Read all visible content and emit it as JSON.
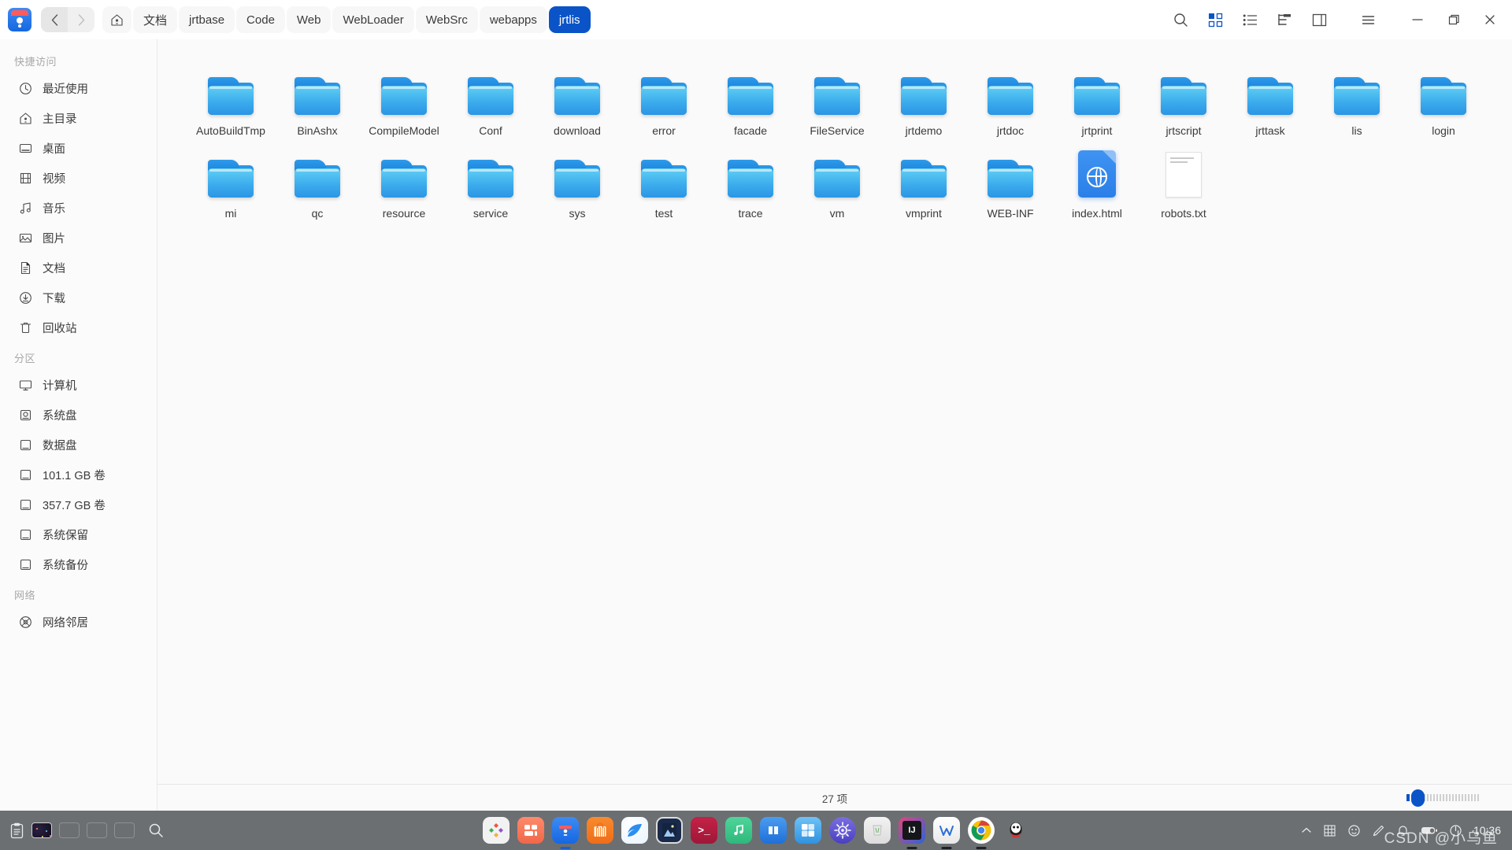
{
  "window": {
    "app_icon": "file-manager-logo",
    "nav": {
      "back": "‹",
      "forward": "›"
    },
    "breadcrumbs": [
      {
        "label": "⌂",
        "name": "home",
        "active": false
      },
      {
        "label": "文档",
        "name": "documents",
        "active": false
      },
      {
        "label": "jrtbase",
        "name": "jrtbase",
        "active": false
      },
      {
        "label": "Code",
        "name": "code",
        "active": false
      },
      {
        "label": "Web",
        "name": "web",
        "active": false
      },
      {
        "label": "WebLoader",
        "name": "webloader",
        "active": false
      },
      {
        "label": "WebSrc",
        "name": "websrc",
        "active": false
      },
      {
        "label": "webapps",
        "name": "webapps",
        "active": false
      },
      {
        "label": "jrtlis",
        "name": "jrtlis",
        "active": true
      }
    ],
    "toolbar_icons": [
      "search-icon",
      "grid-view-icon",
      "list-view-icon",
      "tree-view-icon",
      "split-view-icon",
      "menu-icon"
    ],
    "window_controls": [
      "minimize-icon",
      "maximize-icon",
      "close-icon"
    ],
    "accent_color": "#0b54c8"
  },
  "sidebar": {
    "groups": [
      {
        "title": "快捷访问",
        "items": [
          {
            "label": "最近使用",
            "icon": "clock-icon"
          },
          {
            "label": "主目录",
            "icon": "home-icon"
          },
          {
            "label": "桌面",
            "icon": "desktop-icon"
          },
          {
            "label": "视频",
            "icon": "video-icon"
          },
          {
            "label": "音乐",
            "icon": "music-icon"
          },
          {
            "label": "图片",
            "icon": "picture-icon"
          },
          {
            "label": "文档",
            "icon": "document-icon"
          },
          {
            "label": "下载",
            "icon": "download-icon"
          },
          {
            "label": "回收站",
            "icon": "trash-icon"
          }
        ]
      },
      {
        "title": "分区",
        "items": [
          {
            "label": "计算机",
            "icon": "computer-icon"
          },
          {
            "label": "系统盘",
            "icon": "system-disk-icon"
          },
          {
            "label": "数据盘",
            "icon": "disk-icon"
          },
          {
            "label": "101.1 GB 卷",
            "icon": "disk-icon"
          },
          {
            "label": "357.7 GB 卷",
            "icon": "disk-icon"
          },
          {
            "label": "系统保留",
            "icon": "disk-icon"
          },
          {
            "label": "系统备份",
            "icon": "disk-icon"
          }
        ]
      },
      {
        "title": "网络",
        "items": [
          {
            "label": "网络邻居",
            "icon": "network-icon"
          }
        ]
      }
    ]
  },
  "files": [
    {
      "name": "AutoBuildTmp",
      "type": "folder"
    },
    {
      "name": "BinAshx",
      "type": "folder"
    },
    {
      "name": "CompileModel",
      "type": "folder"
    },
    {
      "name": "Conf",
      "type": "folder"
    },
    {
      "name": "download",
      "type": "folder"
    },
    {
      "name": "error",
      "type": "folder"
    },
    {
      "name": "facade",
      "type": "folder"
    },
    {
      "name": "FileService",
      "type": "folder"
    },
    {
      "name": "jrtdemo",
      "type": "folder"
    },
    {
      "name": "jrtdoc",
      "type": "folder"
    },
    {
      "name": "jrtprint",
      "type": "folder"
    },
    {
      "name": "jrtscript",
      "type": "folder"
    },
    {
      "name": "jrttask",
      "type": "folder"
    },
    {
      "name": "lis",
      "type": "folder"
    },
    {
      "name": "login",
      "type": "folder"
    },
    {
      "name": "mi",
      "type": "folder"
    },
    {
      "name": "qc",
      "type": "folder"
    },
    {
      "name": "resource",
      "type": "folder"
    },
    {
      "name": "service",
      "type": "folder"
    },
    {
      "name": "sys",
      "type": "folder"
    },
    {
      "name": "test",
      "type": "folder"
    },
    {
      "name": "trace",
      "type": "folder"
    },
    {
      "name": "vm",
      "type": "folder"
    },
    {
      "name": "vmprint",
      "type": "folder"
    },
    {
      "name": "WEB-INF",
      "type": "folder"
    },
    {
      "name": "index.html",
      "type": "html"
    },
    {
      "name": "robots.txt",
      "type": "txt"
    }
  ],
  "statusbar": {
    "count_text": "27 项",
    "zoom_slider_name": "icon-size-slider"
  },
  "taskbar": {
    "left_icons": [
      "clipboard-icon",
      "workspace-1",
      "workspace-2",
      "workspace-3",
      "workspace-4",
      "search-icon"
    ],
    "dock": [
      {
        "name": "launcher-icon",
        "label": ""
      },
      {
        "name": "app-grid-icon",
        "label": ""
      },
      {
        "name": "file-manager-icon",
        "label": ""
      },
      {
        "name": "app-store-icon",
        "label": ""
      },
      {
        "name": "browser-icon",
        "label": ""
      },
      {
        "name": "gallery-icon",
        "label": ""
      },
      {
        "name": "terminal-icon",
        "label": ">_"
      },
      {
        "name": "music-icon",
        "label": ""
      },
      {
        "name": "notes-icon",
        "label": ""
      },
      {
        "name": "calculator-icon",
        "label": ""
      },
      {
        "name": "settings-icon",
        "label": ""
      },
      {
        "name": "trash-icon",
        "label": ""
      },
      {
        "name": "intellij-idea-icon",
        "label": "IJ"
      },
      {
        "name": "wps-icon",
        "label": ""
      },
      {
        "name": "chrome-icon",
        "label": ""
      },
      {
        "name": "qq-icon",
        "label": ""
      }
    ],
    "tray_icons": [
      "chevron-up-icon",
      "input-method-icon",
      "voice-icon",
      "pen-icon",
      "bell-icon",
      "battery-icon",
      "power-icon"
    ],
    "clock": "10:36",
    "watermark": "CSDN @小乌鱼"
  }
}
